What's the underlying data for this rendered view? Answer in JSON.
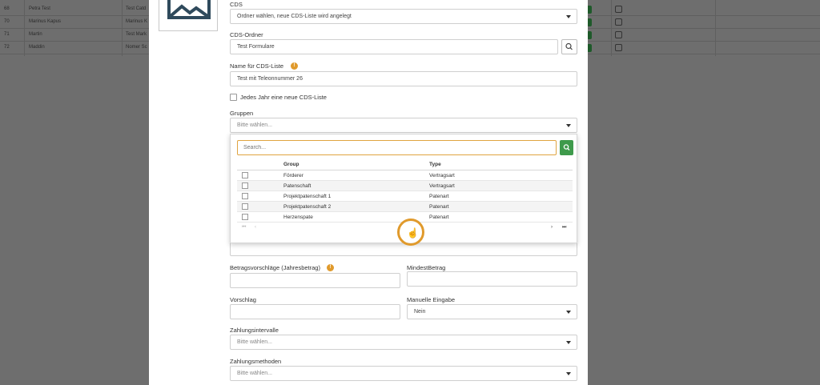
{
  "background_table": {
    "rows": [
      {
        "id": "68",
        "name": "Petra Test",
        "col3": "Test Catd"
      },
      {
        "id": "70",
        "name": "Marinus Kapus",
        "col3": "Marinus K"
      },
      {
        "id": "71",
        "name": "Martin",
        "col3": "Test Mark"
      },
      {
        "id": "72",
        "name": "Maddin",
        "col3": "Nomer Sc"
      }
    ]
  },
  "form": {
    "cds_label": "CDS",
    "cds_value": "Ordner wählen, neue CDS-Liste wird angelegt",
    "cds_folder_label": "CDS-Ordner",
    "cds_folder_value": "Test Formulare",
    "name_label": "Name für CDS-Liste",
    "name_value": "Test mit Teleonnummer 26",
    "yearly_checkbox_label": "Jedes Jahr eine neue CDS-Liste",
    "groups_label": "Gruppen",
    "groups_placeholder": "Bitte wählen...",
    "amount_suggestions_label": "Betragsvorschläge (Jahresbetrag)",
    "min_amount_label": "MindestBetrag",
    "suggestion_label": "Vorschlag",
    "manual_entry_label": "Manuelle Eingabe",
    "manual_entry_value": "Nein",
    "payment_intervals_label": "Zahlungsintervalle",
    "payment_intervals_placeholder": "Bitte wählen...",
    "payment_methods_label": "Zahlungsmethoden",
    "payment_methods_placeholder": "Bitte wählen..."
  },
  "groups_dropdown": {
    "search_placeholder": "Search...",
    "columns": [
      "Group",
      "Type"
    ],
    "rows": [
      {
        "group": "Förderer",
        "type": "Vertragsart"
      },
      {
        "group": "Patenschaft",
        "type": "Vertragsart"
      },
      {
        "group": "Projektpatenschaft 1",
        "type": "Patenart"
      },
      {
        "group": "Projektpatenschaft 2",
        "type": "Patenart"
      },
      {
        "group": "Herzenspate",
        "type": "Patenart"
      }
    ],
    "pager": {
      "first": "⏮",
      "prev": "‹",
      "next": "›",
      "last": "⏭"
    }
  },
  "colors": {
    "accent_orange": "#e09a2c",
    "search_button_green": "#3e9a4b",
    "overlay": "#6e6e6e"
  }
}
